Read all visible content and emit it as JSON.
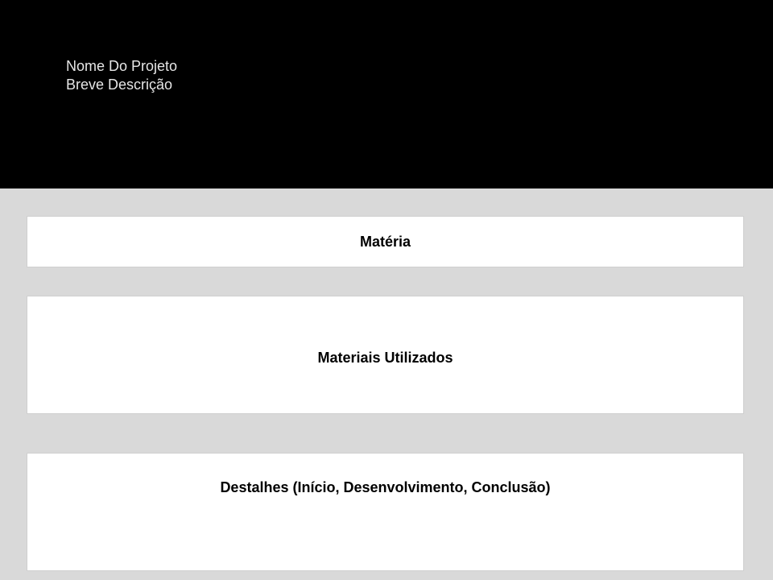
{
  "hero": {
    "project_name": "Nome Do Projeto",
    "short_description": "Breve Descrição"
  },
  "sections": {
    "subject": {
      "title": "Matéria"
    },
    "materials": {
      "title": "Materiais Utilizados"
    },
    "details": {
      "title": "Destalhes (Início, Desenvolvimento, Conclusão)"
    }
  },
  "colors": {
    "hero_background": "#000000",
    "hero_text": "#e6e6e6",
    "page_background": "#d9d9d9",
    "card_background": "#ffffff",
    "title_text": "#000000"
  }
}
